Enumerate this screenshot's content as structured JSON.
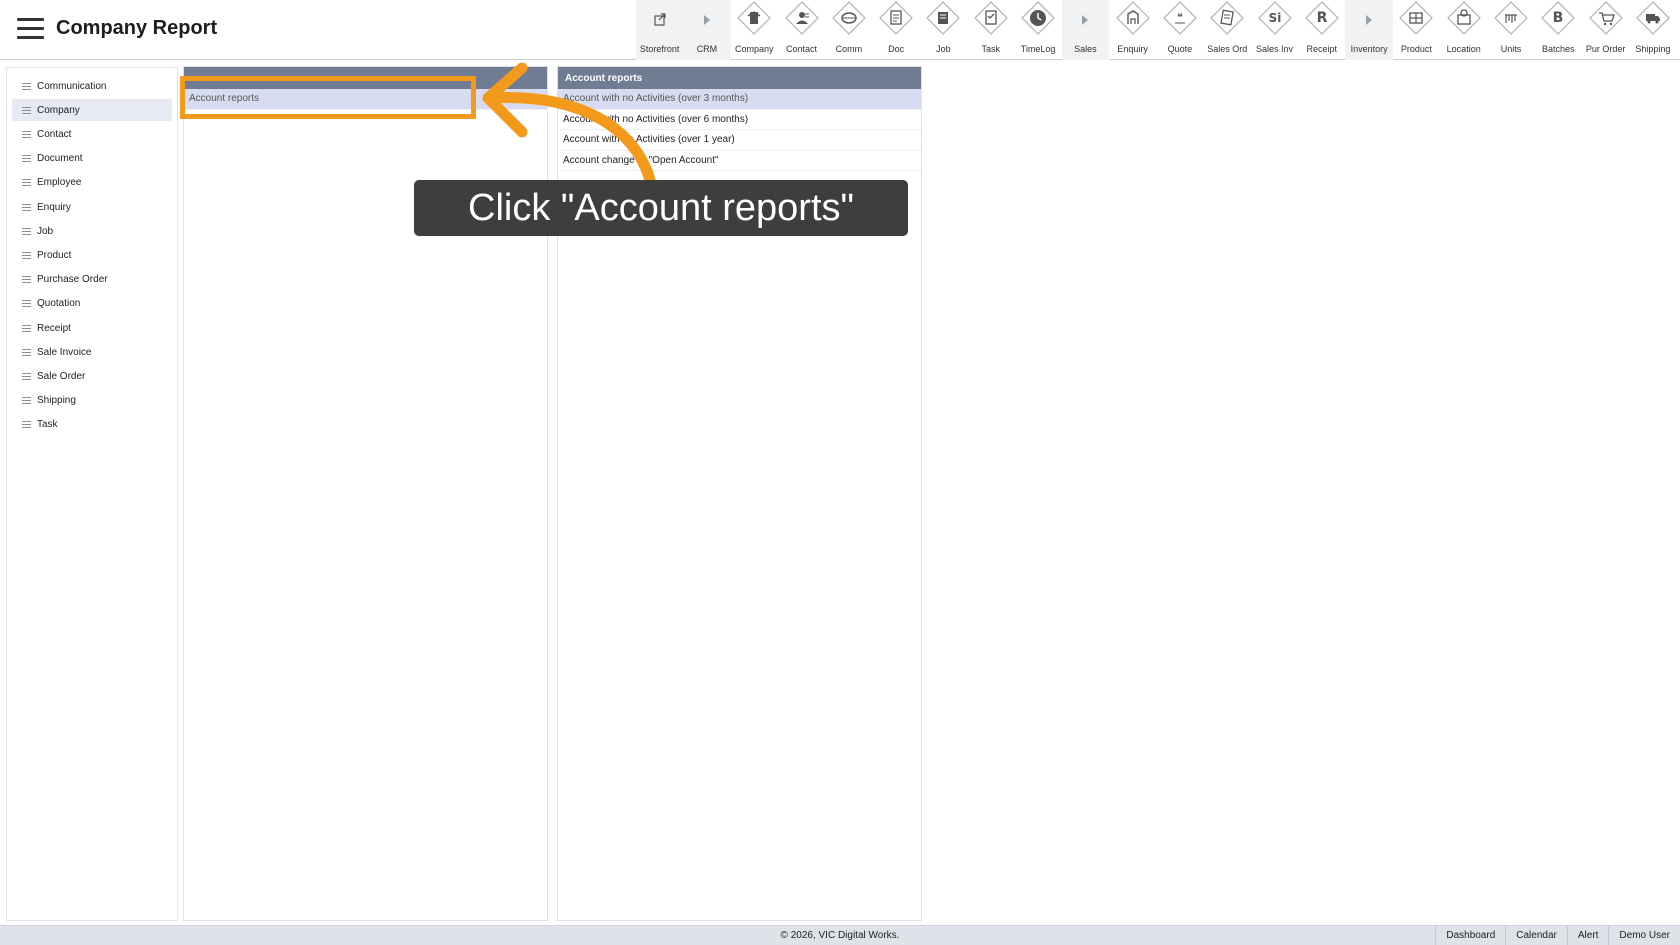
{
  "header": {
    "title": "Company Report",
    "toolbar": [
      {
        "label": "Storefront",
        "icon": "external-link-icon",
        "group": true
      },
      {
        "label": "CRM",
        "icon": "caret-right-icon",
        "group": true
      },
      {
        "label": "Company",
        "icon": "company-icon"
      },
      {
        "label": "Contact",
        "icon": "contact-icon"
      },
      {
        "label": "Comm",
        "icon": "comm-icon"
      },
      {
        "label": "Doc",
        "icon": "doc-icon"
      },
      {
        "label": "Job",
        "icon": "job-icon"
      },
      {
        "label": "Task",
        "icon": "task-icon"
      },
      {
        "label": "TimeLog",
        "icon": "clock-icon"
      },
      {
        "label": "Sales",
        "icon": "caret-right-icon",
        "group": true
      },
      {
        "label": "Enquiry",
        "icon": "enquiry-icon"
      },
      {
        "label": "Quote",
        "icon": "quote-icon"
      },
      {
        "label": "Sales Ord",
        "icon": "sales-order-icon"
      },
      {
        "label": "Sales Inv",
        "icon": "sales-invoice-icon",
        "glyph": "Si"
      },
      {
        "label": "Receipt",
        "icon": "receipt-icon",
        "glyph": "R"
      },
      {
        "label": "Inventory",
        "icon": "caret-right-icon",
        "group": true
      },
      {
        "label": "Product",
        "icon": "product-icon"
      },
      {
        "label": "Location",
        "icon": "location-icon"
      },
      {
        "label": "Units",
        "icon": "units-icon"
      },
      {
        "label": "Batches",
        "icon": "batches-icon",
        "glyph": "B"
      },
      {
        "label": "Pur Order",
        "icon": "cart-icon"
      },
      {
        "label": "Shipping",
        "icon": "truck-icon"
      }
    ]
  },
  "sidebar": {
    "items": [
      {
        "label": "Communication"
      },
      {
        "label": "Company",
        "active": true
      },
      {
        "label": "Contact"
      },
      {
        "label": "Document"
      },
      {
        "label": "Employee"
      },
      {
        "label": "Enquiry"
      },
      {
        "label": "Job"
      },
      {
        "label": "Product"
      },
      {
        "label": "Purchase Order"
      },
      {
        "label": "Quotation"
      },
      {
        "label": "Receipt"
      },
      {
        "label": "Sale Invoice"
      },
      {
        "label": "Sale Order"
      },
      {
        "label": "Shipping"
      },
      {
        "label": "Task"
      }
    ]
  },
  "middle_panel": {
    "header": "",
    "rows": [
      "Account reports"
    ]
  },
  "right_panel": {
    "header": "Account reports",
    "rows": [
      "Account with no Activities (over 3 months)",
      "Account with no Activities (over 6 months)",
      "Account with no Activities (over 1 year)",
      "Account change to \"Open Account\""
    ]
  },
  "tutorial": {
    "tooltip": "Click \"Account reports\"",
    "accent_color": "#f39a1c"
  },
  "footer": {
    "copyright": "© 2026, VIC Digital Works.",
    "links": [
      "Dashboard",
      "Calendar",
      "Alert",
      "Demo User"
    ]
  }
}
